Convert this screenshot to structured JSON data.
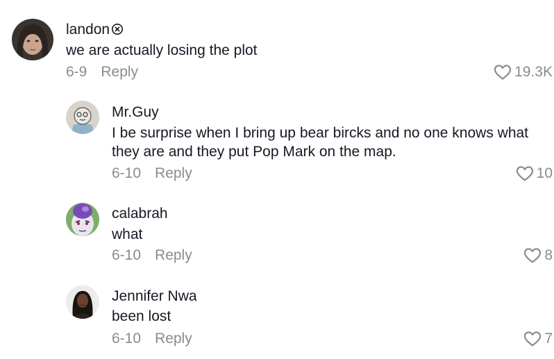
{
  "comments": [
    {
      "username": "landon",
      "text": "we are actually losing the plot",
      "date": "6-9",
      "reply_label": "Reply",
      "likes": "19.3K"
    },
    {
      "username": "Mr.Guy",
      "text": "I be surprise when I bring up bear bircks and no one knows what they are and they put Pop Mark on the map.",
      "date": "6-10",
      "reply_label": "Reply",
      "likes": "10"
    },
    {
      "username": "calabrah",
      "text": "what",
      "date": "6-10",
      "reply_label": "Reply",
      "likes": "8"
    },
    {
      "username": "Jennifer Nwa",
      "text": "been lost",
      "date": "6-10",
      "reply_label": "Reply",
      "likes": "7"
    }
  ],
  "icons": {
    "like": "heart-outline-icon",
    "badge": "circled-x-icon"
  },
  "colors": {
    "text": "#161823",
    "meta": "#8a8b91",
    "background": "#ffffff"
  }
}
